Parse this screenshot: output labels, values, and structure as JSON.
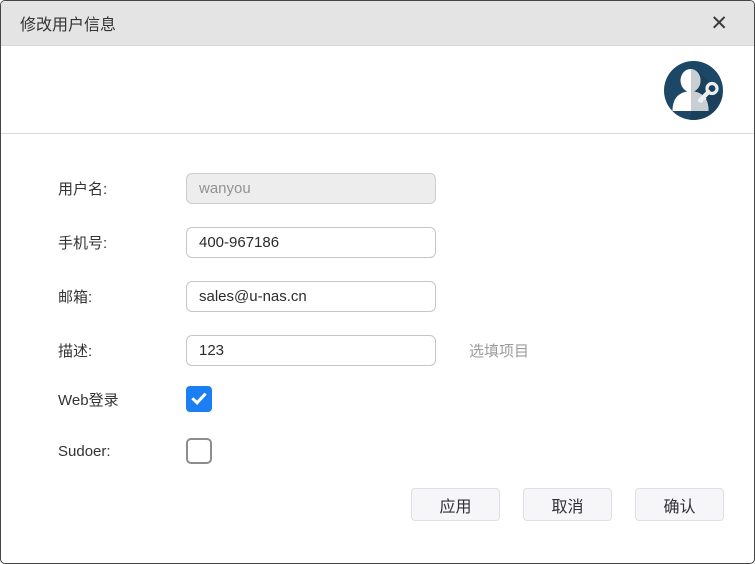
{
  "dialog": {
    "title": "修改用户信息",
    "close_glyph": "✕"
  },
  "form": {
    "fields": [
      {
        "label": "用户名:",
        "value": "wanyou",
        "disabled": true
      },
      {
        "label": "手机号:",
        "value": "400-967186",
        "disabled": false
      },
      {
        "label": "邮箱:",
        "value": "sales@u-nas.cn",
        "disabled": false
      },
      {
        "label": "描述:",
        "value": "123",
        "disabled": false,
        "hint": "选填项目"
      }
    ],
    "checkboxes": [
      {
        "label": "Web登录",
        "checked": true
      },
      {
        "label": "Sudoer:",
        "checked": false
      }
    ]
  },
  "footer": {
    "buttons": [
      {
        "label": "应用"
      },
      {
        "label": "取消"
      },
      {
        "label": "确认"
      }
    ]
  },
  "colors": {
    "titlebar_bg": "#e4e4e4",
    "checkbox_checked": "#1b7ef2",
    "avatar_circle": "#1d4767",
    "avatar_shade": "#c9ced3",
    "dialog_border": "#454545"
  }
}
